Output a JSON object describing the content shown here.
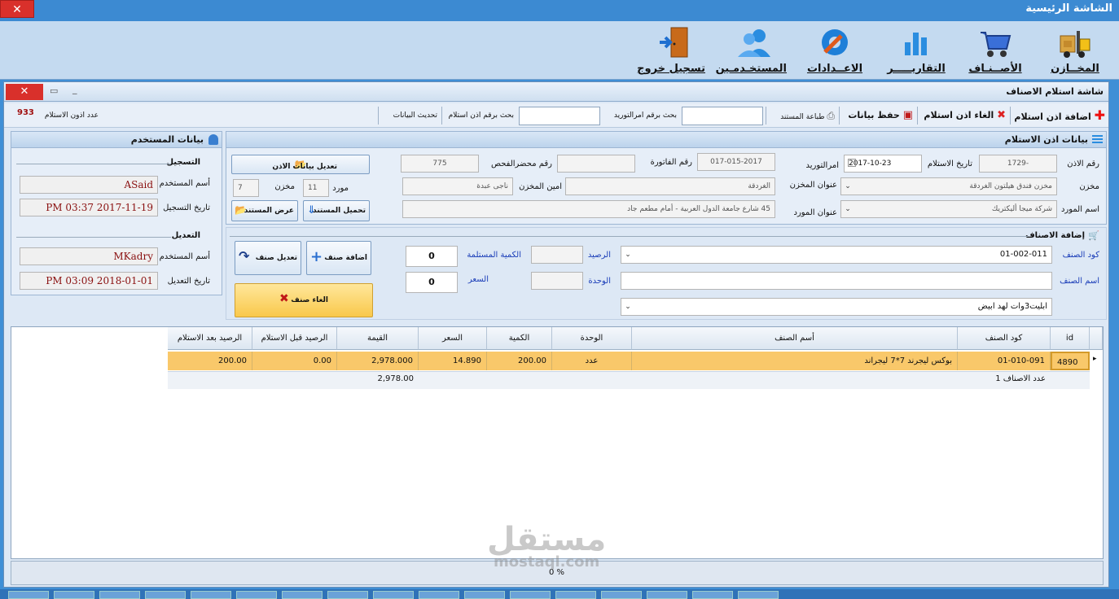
{
  "outer": {
    "title": "الشاشة الرئيسية",
    "close": "✕"
  },
  "menu": [
    {
      "label": "المخــازن",
      "icon": "forklift-icon"
    },
    {
      "label": "الأصــنـاف",
      "icon": "cart-icon"
    },
    {
      "label": "التقاريـــــر",
      "icon": "bar-chart-icon"
    },
    {
      "label": "الاعــدادات",
      "icon": "settings-icon"
    },
    {
      "label": "المستخـدمـين",
      "icon": "users-icon"
    },
    {
      "label": "تسجيل خروج",
      "icon": "logout-door-icon"
    }
  ],
  "window": {
    "title": "شاشة استلام الاصناف",
    "close": "✕",
    "maximize": "▭",
    "minimize": "_"
  },
  "toolbar": {
    "add": "اضافة اذن استلام",
    "cancel": "الغاء اذن استلام",
    "save": "حفظ بيانات",
    "print": "طباعة المستند",
    "search_supply": "بحث برقم امرالتوريد",
    "search_receipt": "بحث برقم اذن استلام",
    "refresh": "تحديث البيانات",
    "count_label": "عدد اذون الاستلام",
    "count_value": "933"
  },
  "receipt": {
    "header": "بيانات اذن الاستلام",
    "permit_no_label": "رقم الاذن",
    "permit_no": "1729-",
    "date_label": "تاريخ الاستلام",
    "date": "2017-10-23",
    "supply_order_label": "امرالتوريد",
    "invoice_label": "رقم الفاتورة",
    "invoice": "017-015-2017",
    "inspection_label": "رقم محضرالفحص",
    "inspection": "775",
    "edit_btn": "تعديل بيانات الاذن",
    "store_label": "مخزن",
    "store": "مخزن فندق هيلتون الغردقة",
    "store_address_label": "عنوان المخزن",
    "store_address": "الغردقة",
    "keeper_label": "امين المخزن",
    "keeper": "ناجى عبدة",
    "store_num_label": "مخزن",
    "store_num": "7",
    "supplier_num_label": "مورد",
    "supplier_num": "11",
    "supplier_label": "اسم المورد",
    "supplier": "شركة ميجا أليكتريك",
    "supplier_address_label": "عنوان المورد",
    "supplier_address": "45 شارع جامعة الدول العربية - أمام مطعم جاد",
    "upload_btn": "تحميل المستند",
    "view_btn": "عرض المستند"
  },
  "user": {
    "header": "بيانات المستخدم",
    "reg_title": "التسجيل",
    "reg_user_label": "أسم المستخدم",
    "reg_user": "ASaid",
    "reg_date_label": "تاريخ التسجيل",
    "reg_date": "PM 03:37 2017-11-19",
    "mod_title": "التعديل",
    "mod_user_label": "أسم المستخدم",
    "mod_user": "MKadry",
    "mod_date_label": "تاريخ التعديل",
    "mod_date": "PM 03:09 2018-01-01"
  },
  "items_form": {
    "title": "إضافة الاصناف",
    "code_label": "كود الصنف",
    "code": "01-002-011",
    "name_label": "اسم الصنف",
    "name": "",
    "desc": "ابليت3وات لهد ابيض",
    "balance_label": "الرصيد",
    "balance": "",
    "unit_label": "الوحدة",
    "unit": "",
    "qty_label": "الكمية المستلمة",
    "qty": "0",
    "price_label": "السعر",
    "price": "0",
    "add_btn": "اضافة صنف",
    "edit_btn": "تعديل صنف",
    "cancel_btn": "الغاء صنف"
  },
  "grid": {
    "columns": [
      "id",
      "كود الصنف",
      "أسم الصنف",
      "الوحدة",
      "الكمية",
      "السعر",
      "القيمة",
      "الرصيد قبل الاستلام",
      "الرصيد بعد الاستلام"
    ],
    "row": {
      "id": "4890",
      "code": "01-010-091",
      "name": "بوكس ليجرند 7*7  ليجراند",
      "unit": "عدد",
      "qty": "200.00",
      "price": "14.890",
      "value": "2,978.000",
      "before": "0.00",
      "after": "200.00"
    },
    "summary_count": "عدد الاصناف 1",
    "summary_value": "2,978.00"
  },
  "footer": {
    "progress": "0 %"
  },
  "watermark": {
    "line1": "مستقل",
    "line2": "mostaql.com"
  }
}
